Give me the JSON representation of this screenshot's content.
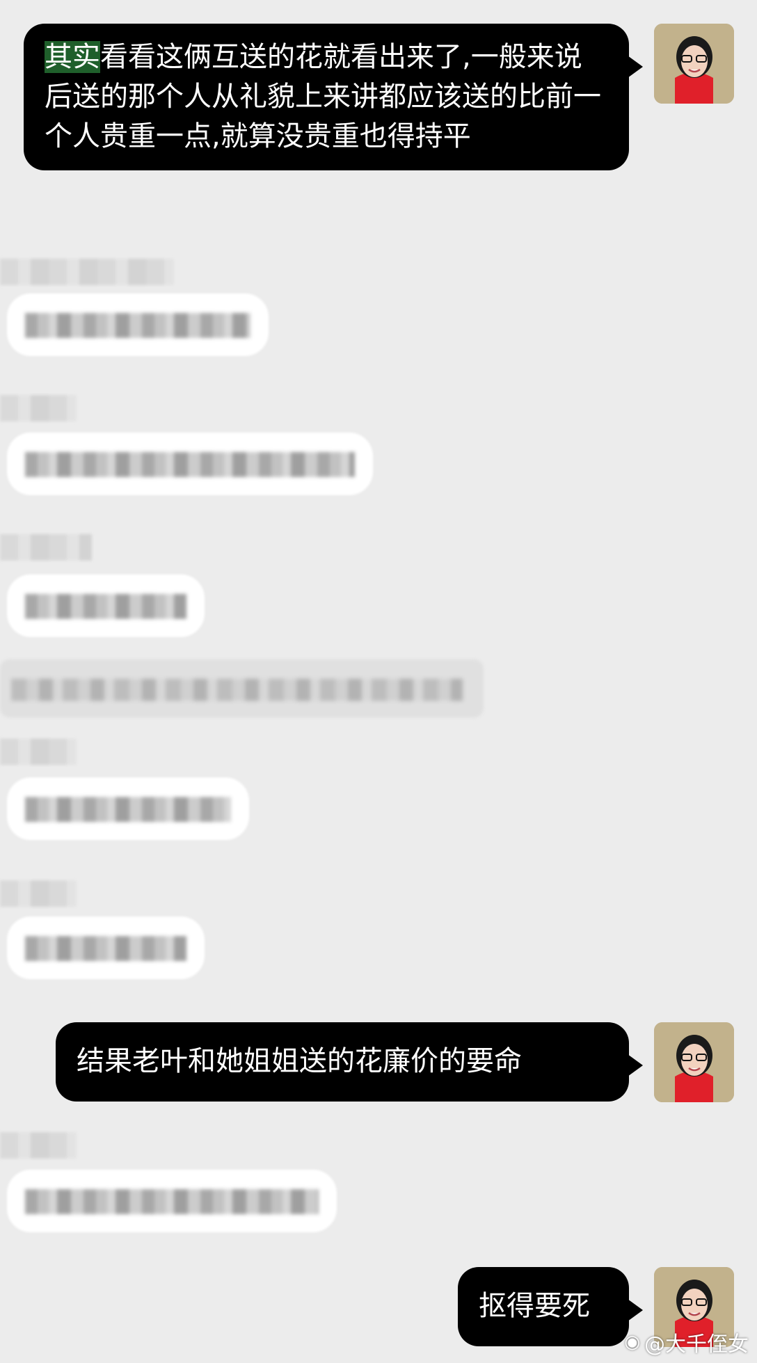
{
  "messages": [
    {
      "side": "out",
      "text_highlight": "其实",
      "text": "看看这俩互送的花就看出来了,一般来说后送的那个人从礼貌上来讲都应该送的比前一个人贵重一点,就算没贵重也得持平"
    },
    {
      "side": "out",
      "text": "结果老叶和她姐姐送的花廉价的要命"
    },
    {
      "side": "out",
      "text": "抠得要死"
    }
  ],
  "watermark": "@大千侄女",
  "avatar_icon": "user-avatar-photo",
  "colors": {
    "background": "#ececec",
    "out_bubble": "#000000",
    "highlight": "#1f5f2b"
  }
}
